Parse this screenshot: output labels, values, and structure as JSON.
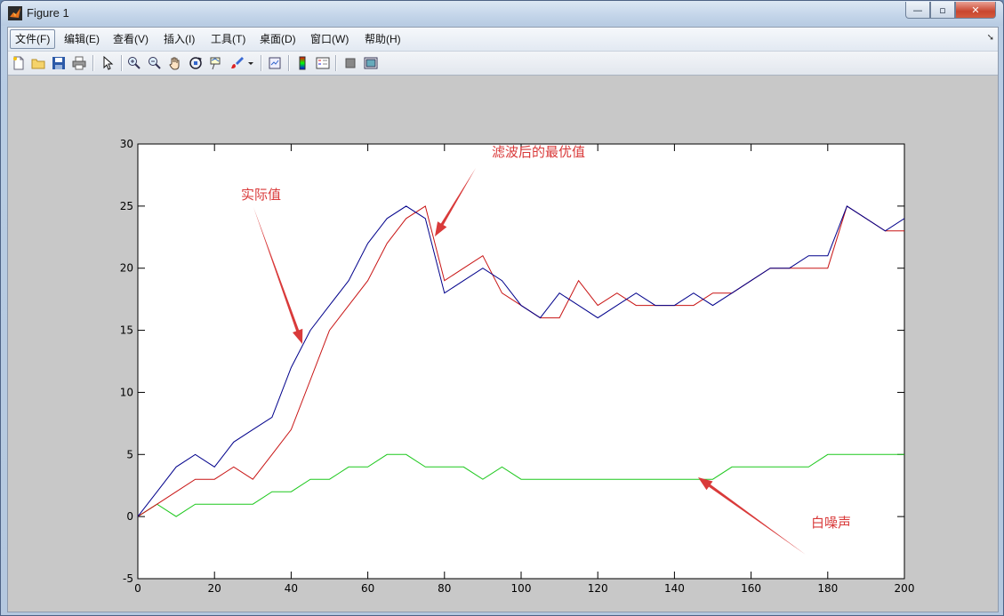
{
  "window": {
    "title": "Figure 1",
    "minimize": "—",
    "maximize": "▫",
    "close": "✕"
  },
  "menu": [
    {
      "label": "文件(F)",
      "active": true
    },
    {
      "label": "编辑(E)"
    },
    {
      "label": "查看(V)"
    },
    {
      "label": "插入(I)"
    },
    {
      "label": "工具(T)"
    },
    {
      "label": "桌面(D)"
    },
    {
      "label": "窗口(W)"
    },
    {
      "label": "帮助(H)"
    }
  ],
  "toolbar": [
    "new-figure-icon",
    "open-file-icon",
    "save-icon",
    "print-icon",
    "pointer-icon",
    "zoom-in-icon",
    "zoom-out-icon",
    "pan-hand-icon",
    "rotate-3d-icon",
    "data-cursor-icon",
    "brush-icon",
    "brush-dropdown-icon",
    "link-plot-icon",
    "colorbar-icon",
    "legend-icon",
    "hide-plot-tools-icon",
    "show-plot-tools-icon"
  ],
  "colors": {
    "actual": "#00008b",
    "filtered": "#c81414",
    "noise": "#1ec81e",
    "annotation": "#d93a3a"
  },
  "annotations": [
    {
      "id": "actual",
      "text": "实际值"
    },
    {
      "id": "filtered",
      "text": "滤波后的最优值"
    },
    {
      "id": "noise",
      "text": "白噪声"
    }
  ],
  "chart_data": {
    "type": "line",
    "xlim": [
      0,
      200
    ],
    "ylim": [
      -5,
      30
    ],
    "xticks": [
      0,
      20,
      40,
      60,
      80,
      100,
      120,
      140,
      160,
      180,
      200
    ],
    "yticks": [
      -5,
      0,
      5,
      10,
      15,
      20,
      25,
      30
    ],
    "grid": false,
    "series": [
      {
        "name": "实际值",
        "color": "#00008b",
        "x": [
          0,
          5,
          10,
          15,
          20,
          25,
          30,
          35,
          40,
          45,
          50,
          55,
          60,
          65,
          70,
          75,
          80,
          85,
          90,
          95,
          100,
          105,
          110,
          115,
          120,
          125,
          130,
          135,
          140,
          145,
          150,
          155,
          160,
          165,
          170,
          175,
          180,
          185,
          190,
          195,
          200
        ],
        "y": [
          0,
          2,
          4,
          5,
          4,
          6,
          7,
          8,
          12,
          15,
          17,
          19,
          22,
          24,
          25,
          24,
          18,
          19,
          20,
          19,
          17,
          16,
          18,
          17,
          16,
          17,
          18,
          17,
          17,
          18,
          17,
          18,
          19,
          20,
          20,
          21,
          21,
          25,
          24,
          23,
          24
        ]
      },
      {
        "name": "滤波后的最优值",
        "color": "#c81414",
        "x": [
          0,
          5,
          10,
          15,
          20,
          25,
          30,
          35,
          40,
          45,
          50,
          55,
          60,
          65,
          70,
          75,
          80,
          85,
          90,
          95,
          100,
          105,
          110,
          115,
          120,
          125,
          130,
          135,
          140,
          145,
          150,
          155,
          160,
          165,
          170,
          175,
          180,
          185,
          190,
          195,
          200
        ],
        "y": [
          0,
          1,
          2,
          3,
          3,
          4,
          3,
          5,
          7,
          11,
          15,
          17,
          19,
          22,
          24,
          25,
          19,
          20,
          21,
          18,
          17,
          16,
          16,
          19,
          17,
          18,
          17,
          17,
          17,
          17,
          18,
          18,
          19,
          20,
          20,
          20,
          20,
          25,
          24,
          23,
          23
        ]
      },
      {
        "name": "白噪声",
        "color": "#1ec81e",
        "x": [
          0,
          5,
          10,
          15,
          20,
          25,
          30,
          35,
          40,
          45,
          50,
          55,
          60,
          65,
          70,
          75,
          80,
          85,
          90,
          95,
          100,
          105,
          110,
          115,
          120,
          125,
          130,
          135,
          140,
          145,
          150,
          155,
          160,
          165,
          170,
          175,
          180,
          185,
          190,
          195,
          200
        ],
        "y": [
          0,
          1,
          0,
          1,
          1,
          1,
          1,
          2,
          2,
          3,
          3,
          4,
          4,
          5,
          5,
          4,
          4,
          4,
          3,
          4,
          3,
          3,
          3,
          3,
          3,
          3,
          3,
          3,
          3,
          3,
          3,
          4,
          4,
          4,
          4,
          4,
          5,
          5,
          5,
          5,
          5
        ]
      }
    ]
  }
}
